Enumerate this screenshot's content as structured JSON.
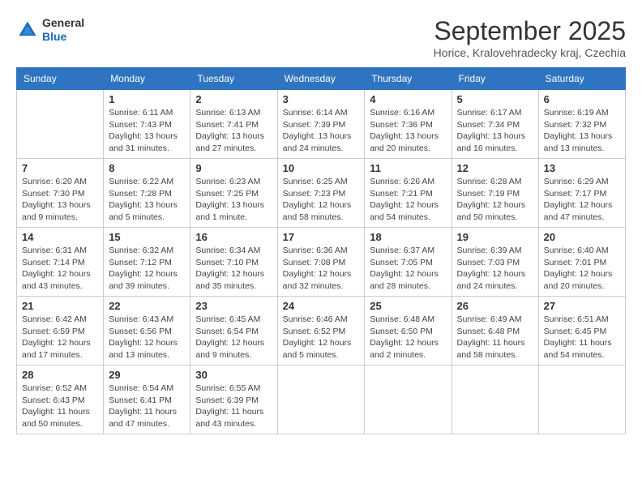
{
  "logo": {
    "line1": "General",
    "line2": "Blue"
  },
  "title": "September 2025",
  "location": "Horice, Kralovehradecky kraj, Czechia",
  "weekdays": [
    "Sunday",
    "Monday",
    "Tuesday",
    "Wednesday",
    "Thursday",
    "Friday",
    "Saturday"
  ],
  "weeks": [
    [
      {
        "day": "",
        "info": ""
      },
      {
        "day": "1",
        "info": "Sunrise: 6:11 AM\nSunset: 7:43 PM\nDaylight: 13 hours\nand 31 minutes."
      },
      {
        "day": "2",
        "info": "Sunrise: 6:13 AM\nSunset: 7:41 PM\nDaylight: 13 hours\nand 27 minutes."
      },
      {
        "day": "3",
        "info": "Sunrise: 6:14 AM\nSunset: 7:39 PM\nDaylight: 13 hours\nand 24 minutes."
      },
      {
        "day": "4",
        "info": "Sunrise: 6:16 AM\nSunset: 7:36 PM\nDaylight: 13 hours\nand 20 minutes."
      },
      {
        "day": "5",
        "info": "Sunrise: 6:17 AM\nSunset: 7:34 PM\nDaylight: 13 hours\nand 16 minutes."
      },
      {
        "day": "6",
        "info": "Sunrise: 6:19 AM\nSunset: 7:32 PM\nDaylight: 13 hours\nand 13 minutes."
      }
    ],
    [
      {
        "day": "7",
        "info": "Sunrise: 6:20 AM\nSunset: 7:30 PM\nDaylight: 13 hours\nand 9 minutes."
      },
      {
        "day": "8",
        "info": "Sunrise: 6:22 AM\nSunset: 7:28 PM\nDaylight: 13 hours\nand 5 minutes."
      },
      {
        "day": "9",
        "info": "Sunrise: 6:23 AM\nSunset: 7:25 PM\nDaylight: 13 hours\nand 1 minute."
      },
      {
        "day": "10",
        "info": "Sunrise: 6:25 AM\nSunset: 7:23 PM\nDaylight: 12 hours\nand 58 minutes."
      },
      {
        "day": "11",
        "info": "Sunrise: 6:26 AM\nSunset: 7:21 PM\nDaylight: 12 hours\nand 54 minutes."
      },
      {
        "day": "12",
        "info": "Sunrise: 6:28 AM\nSunset: 7:19 PM\nDaylight: 12 hours\nand 50 minutes."
      },
      {
        "day": "13",
        "info": "Sunrise: 6:29 AM\nSunset: 7:17 PM\nDaylight: 12 hours\nand 47 minutes."
      }
    ],
    [
      {
        "day": "14",
        "info": "Sunrise: 6:31 AM\nSunset: 7:14 PM\nDaylight: 12 hours\nand 43 minutes."
      },
      {
        "day": "15",
        "info": "Sunrise: 6:32 AM\nSunset: 7:12 PM\nDaylight: 12 hours\nand 39 minutes."
      },
      {
        "day": "16",
        "info": "Sunrise: 6:34 AM\nSunset: 7:10 PM\nDaylight: 12 hours\nand 35 minutes."
      },
      {
        "day": "17",
        "info": "Sunrise: 6:36 AM\nSunset: 7:08 PM\nDaylight: 12 hours\nand 32 minutes."
      },
      {
        "day": "18",
        "info": "Sunrise: 6:37 AM\nSunset: 7:05 PM\nDaylight: 12 hours\nand 28 minutes."
      },
      {
        "day": "19",
        "info": "Sunrise: 6:39 AM\nSunset: 7:03 PM\nDaylight: 12 hours\nand 24 minutes."
      },
      {
        "day": "20",
        "info": "Sunrise: 6:40 AM\nSunset: 7:01 PM\nDaylight: 12 hours\nand 20 minutes."
      }
    ],
    [
      {
        "day": "21",
        "info": "Sunrise: 6:42 AM\nSunset: 6:59 PM\nDaylight: 12 hours\nand 17 minutes."
      },
      {
        "day": "22",
        "info": "Sunrise: 6:43 AM\nSunset: 6:56 PM\nDaylight: 12 hours\nand 13 minutes."
      },
      {
        "day": "23",
        "info": "Sunrise: 6:45 AM\nSunset: 6:54 PM\nDaylight: 12 hours\nand 9 minutes."
      },
      {
        "day": "24",
        "info": "Sunrise: 6:46 AM\nSunset: 6:52 PM\nDaylight: 12 hours\nand 5 minutes."
      },
      {
        "day": "25",
        "info": "Sunrise: 6:48 AM\nSunset: 6:50 PM\nDaylight: 12 hours\nand 2 minutes."
      },
      {
        "day": "26",
        "info": "Sunrise: 6:49 AM\nSunset: 6:48 PM\nDaylight: 11 hours\nand 58 minutes."
      },
      {
        "day": "27",
        "info": "Sunrise: 6:51 AM\nSunset: 6:45 PM\nDaylight: 11 hours\nand 54 minutes."
      }
    ],
    [
      {
        "day": "28",
        "info": "Sunrise: 6:52 AM\nSunset: 6:43 PM\nDaylight: 11 hours\nand 50 minutes."
      },
      {
        "day": "29",
        "info": "Sunrise: 6:54 AM\nSunset: 6:41 PM\nDaylight: 11 hours\nand 47 minutes."
      },
      {
        "day": "30",
        "info": "Sunrise: 6:55 AM\nSunset: 6:39 PM\nDaylight: 11 hours\nand 43 minutes."
      },
      {
        "day": "",
        "info": ""
      },
      {
        "day": "",
        "info": ""
      },
      {
        "day": "",
        "info": ""
      },
      {
        "day": "",
        "info": ""
      }
    ]
  ]
}
